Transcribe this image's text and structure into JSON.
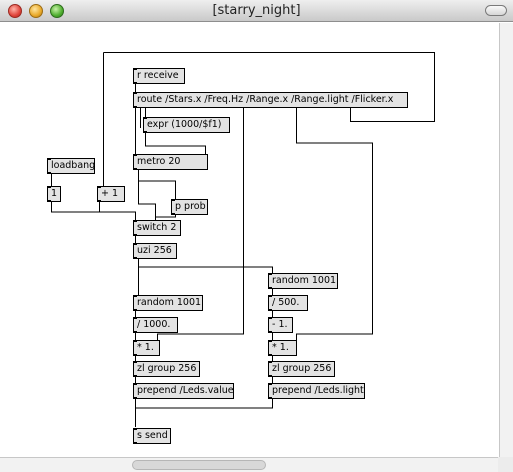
{
  "window": {
    "title": "[starry_night]"
  },
  "objects": {
    "r_receive": "r receive",
    "route": "route /Stars.x /Freq.Hz /Range.x /Range.light /Flicker.x",
    "expr": "expr (1000/$f1)",
    "metro": "metro 20",
    "loadbang": "loadbang",
    "num_one": "1",
    "plus_one": "+ 1",
    "p_prob": "p prob",
    "switch": "switch 2",
    "uzi": "uzi 256",
    "random_left": "random 1001",
    "div_left": "/ 1000.",
    "mul_left": "* 1.",
    "zl_left": "zl group 256",
    "prepend_left": "prepend /Leds.value",
    "random_right": "random 1001",
    "div_right": "/ 500.",
    "sub_right": "- 1.",
    "mul_right": "* 1.",
    "zl_right": "zl group 256",
    "prepend_right": "prepend /Leds.light",
    "s_send": "s send"
  }
}
